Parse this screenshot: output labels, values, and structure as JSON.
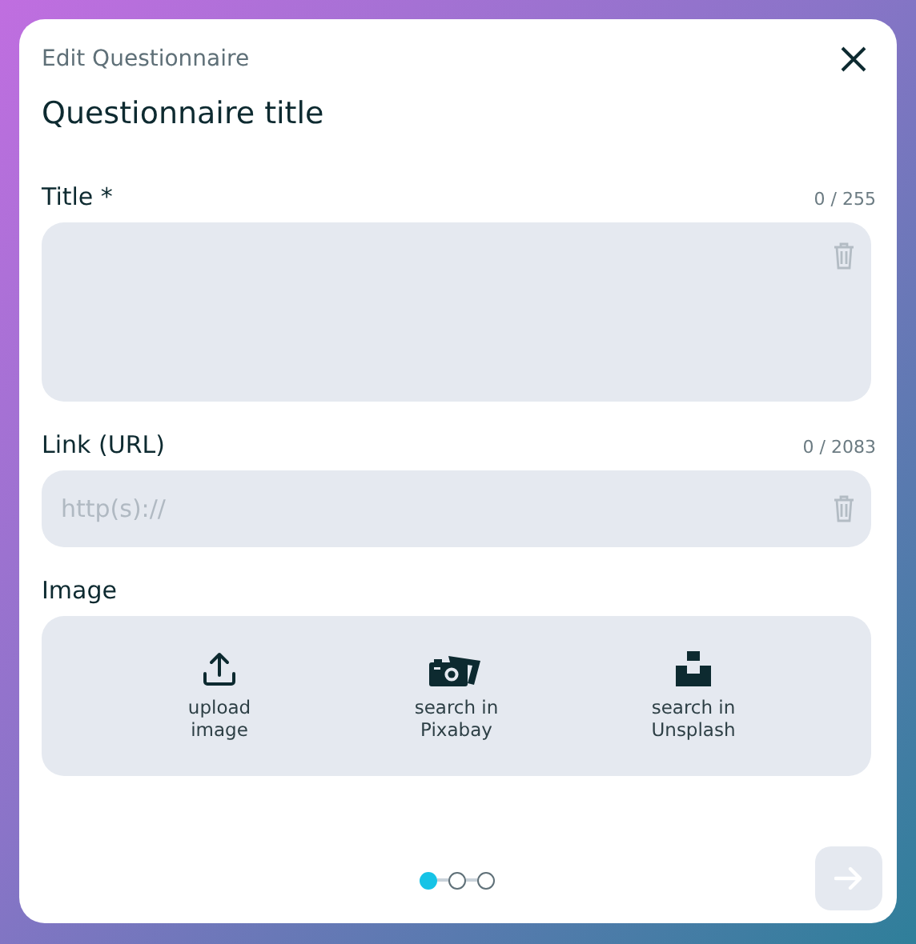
{
  "dialog": {
    "subtitle": "Edit Questionnaire",
    "title": "Questionnaire title"
  },
  "fields": [
    {
      "kind": "textarea",
      "label": "Title *",
      "counter": "0 / 255"
    },
    {
      "kind": "input",
      "label": "Link (URL)",
      "counter": "0 / 2083",
      "placeholder": "http(s)://"
    }
  ],
  "image": {
    "label": "Image",
    "options": [
      {
        "kind": "upload",
        "label": "upload image"
      },
      {
        "kind": "pixabay",
        "label": "search in Pixabay"
      },
      {
        "kind": "unsplash",
        "label": "search in Unsplash"
      }
    ]
  },
  "steps": [
    {
      "selected": true
    },
    {
      "selected": false
    },
    {
      "selected": false
    }
  ],
  "next_button": {
    "disabled": true
  }
}
